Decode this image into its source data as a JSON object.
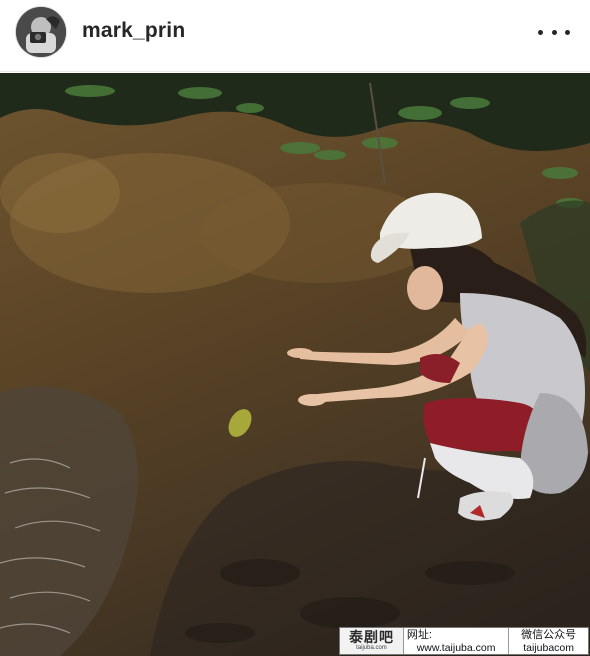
{
  "post": {
    "username": "mark_prin",
    "avatar_icon": "profile-photo",
    "more_icon": "more-horizontal-icon"
  },
  "photo": {
    "icon": "post-photo"
  },
  "watermark": {
    "logo_big": "泰剧吧",
    "logo_small": "taijuba.com",
    "label_web": "网址:",
    "url": "www.taijuba.com",
    "label_wechat": "微信公众号",
    "wechat_id": "taijubacom"
  }
}
